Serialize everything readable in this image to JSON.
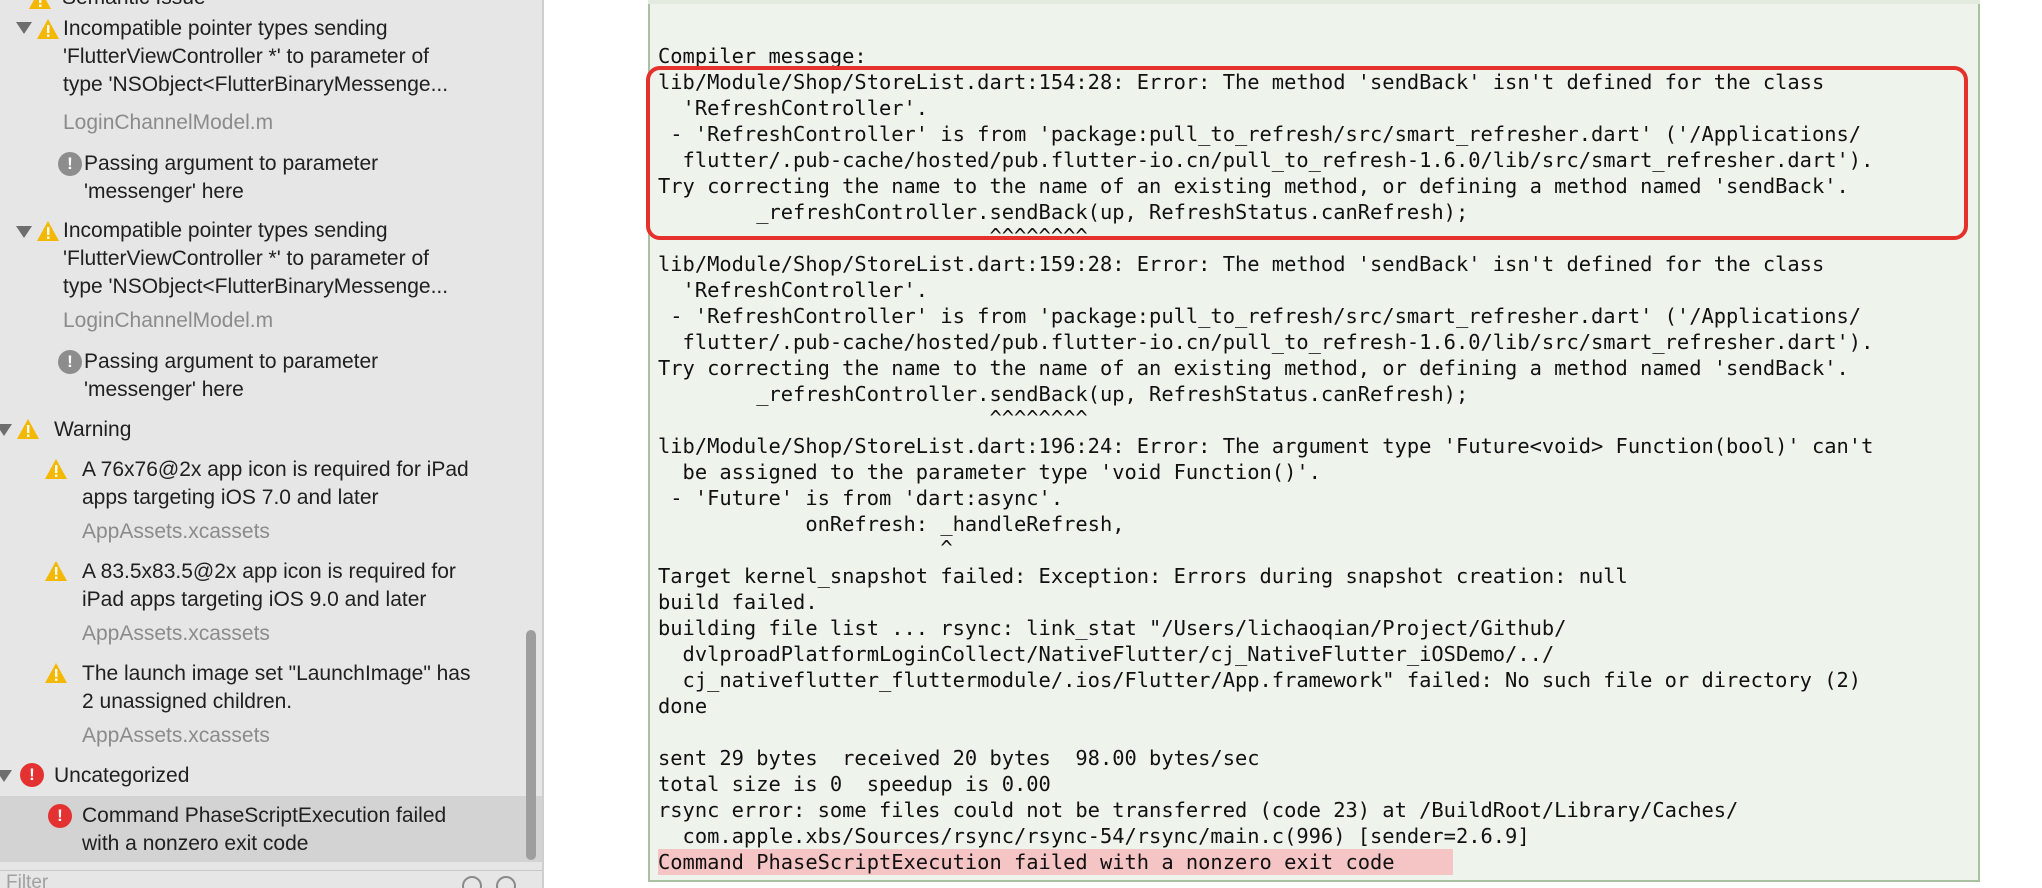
{
  "sidebar": {
    "top_partial": "Semantic Issue",
    "issues": [
      {
        "lines": [
          "Incompatible pointer types sending",
          "'FlutterViewController *' to parameter of",
          "type 'NSObject<FlutterBinaryMessenge..."
        ],
        "file": "LoginChannelModel.m",
        "note": [
          "Passing argument to parameter",
          "'messenger' here"
        ]
      },
      {
        "lines": [
          "Incompatible pointer types sending",
          "'FlutterViewController *' to parameter of",
          "type 'NSObject<FlutterBinaryMessenge..."
        ],
        "file": "LoginChannelModel.m",
        "note": [
          "Passing argument to parameter",
          "'messenger' here"
        ]
      }
    ],
    "warning_group": "Warning",
    "warnings": [
      {
        "lines": [
          "A 76x76@2x app icon is required for iPad",
          "apps targeting iOS 7.0 and later"
        ],
        "file": "AppAssets.xcassets"
      },
      {
        "lines": [
          "A 83.5x83.5@2x app icon is required for",
          "iPad apps targeting iOS 9.0 and later"
        ],
        "file": "AppAssets.xcassets"
      },
      {
        "lines": [
          "The launch image set \"LaunchImage\" has",
          "2 unassigned children."
        ],
        "file": "AppAssets.xcassets"
      }
    ],
    "uncategorized_group": "Uncategorized",
    "uncategorized": {
      "lines": [
        "Command PhaseScriptExecution failed",
        "with a nonzero exit code"
      ]
    },
    "filter_placeholder": "Filter",
    "icons": {
      "warning": "warning-triangle-icon",
      "error": "error-circle-icon",
      "note": "note-circle-icon",
      "disclosure": "disclosure-triangle-icon"
    },
    "colors": {
      "warning": "#f5b800",
      "error": "#e43131",
      "note": "#8d8d8d",
      "file": "#8b8b8b"
    }
  },
  "log": {
    "lines": [
      "Compiler message:",
      "lib/Module/Shop/StoreList.dart:154:28: Error: The method 'sendBack' isn't defined for the class",
      "  'RefreshController'.",
      " - 'RefreshController' is from 'package:pull_to_refresh/src/smart_refresher.dart' ('/Applications/",
      "  flutter/.pub-cache/hosted/pub.flutter-io.cn/pull_to_refresh-1.6.0/lib/src/smart_refresher.dart').",
      "Try correcting the name to the name of an existing method, or defining a method named 'sendBack'.",
      "        _refreshController.sendBack(up, RefreshStatus.canRefresh);",
      "                           ^^^^^^^^",
      "lib/Module/Shop/StoreList.dart:159:28: Error: The method 'sendBack' isn't defined for the class",
      "  'RefreshController'.",
      " - 'RefreshController' is from 'package:pull_to_refresh/src/smart_refresher.dart' ('/Applications/",
      "  flutter/.pub-cache/hosted/pub.flutter-io.cn/pull_to_refresh-1.6.0/lib/src/smart_refresher.dart').",
      "Try correcting the name to the name of an existing method, or defining a method named 'sendBack'.",
      "        _refreshController.sendBack(up, RefreshStatus.canRefresh);",
      "                           ^^^^^^^^",
      "lib/Module/Shop/StoreList.dart:196:24: Error: The argument type 'Future<void> Function(bool)' can't",
      "  be assigned to the parameter type 'void Function()'.",
      " - 'Future' is from 'dart:async'.",
      "            onRefresh: _handleRefresh,",
      "                       ^",
      "Target kernel_snapshot failed: Exception: Errors during snapshot creation: null",
      "build failed.",
      "building file list ... rsync: link_stat \"/Users/lichaoqian/Project/Github/",
      "  dvlproadPlatformLoginCollect/NativeFlutter/cj_NativeFlutter_iOSDemo/../",
      "  cj_nativeflutter_fluttermodule/.ios/Flutter/App.framework\" failed: No such file or directory (2)",
      "done",
      "",
      "sent 29 bytes  received 20 bytes  98.00 bytes/sec",
      "total size is 0  speedup is 0.00",
      "rsync error: some files could not be transferred (code 23) at /BuildRoot/Library/Caches/",
      "  com.apple.xbs/Sources/rsync/rsync-54/rsync/main.c(996) [sender=2.6.9]",
      "Command PhaseScriptExecution failed with a nonzero exit code"
    ],
    "highlight_color": "#e5312b",
    "final_line_bg": "#f5c4c4"
  }
}
